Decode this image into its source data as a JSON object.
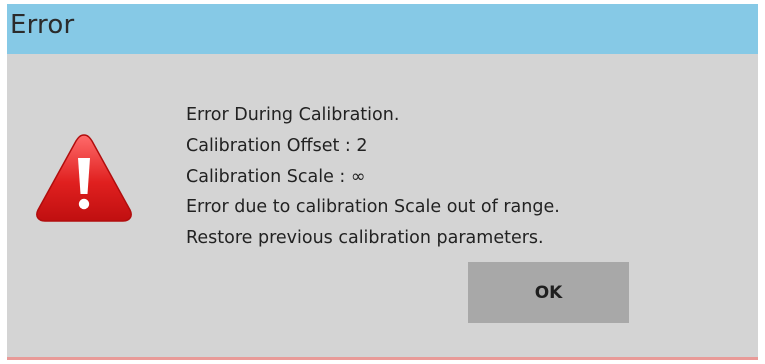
{
  "dialog": {
    "title": "Error",
    "icon": "warning-triangle-icon",
    "message_lines": [
      "Error During Calibration.",
      "Calibration Offset : 2",
      "Calibration Scale : ∞",
      "Error due to calibration Scale out of range.",
      "Restore previous calibration parameters."
    ],
    "ok_label": "OK"
  },
  "colors": {
    "titlebar": "#86c9e6",
    "body": "#d4d4d4",
    "button": "#a8a8a8",
    "warning_red": "#e0201f",
    "bottom_strip": "#e99a98"
  }
}
